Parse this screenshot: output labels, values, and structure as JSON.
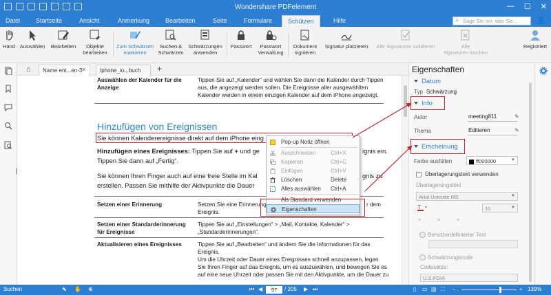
{
  "app_title": "Wondershare PDFelement",
  "menu": [
    "Datei",
    "Startseite",
    "Ansicht",
    "Anmerkung",
    "Bearbeiten",
    "Seite",
    "Formulare",
    "Schützen",
    "Hilfe"
  ],
  "search_placeholder": "Sage Sie mir, was Sie...",
  "ribbon": {
    "hand": "Hand",
    "select": "Auswählen",
    "edit": "Bearbeiten",
    "edit_objects": [
      "Objekte",
      "bearbeiten"
    ],
    "mark_redact": [
      "Zum Schwärzen",
      "markieren"
    ],
    "search_redact": [
      "Suchen &",
      "Schwärzen"
    ],
    "apply_redact": [
      "Schwärzungen",
      "anwenden"
    ],
    "password": "Passwort",
    "password_mgmt": [
      "Passwort",
      "Verwaltung"
    ],
    "sign_doc": [
      "Dokument",
      "signieren"
    ],
    "place_sig": "Signatur platzieren",
    "validate_all": "Alle Signaturen validieren",
    "delete_all": [
      "Alle",
      "Signaturen löschen"
    ],
    "registered": "Registriert"
  },
  "tabs": [
    {
      "label": "Name ent...en-3",
      "active": true
    },
    {
      "label": "Iphone_io...buch",
      "active": false
    }
  ],
  "document": {
    "row1_label": [
      "Auswählen der Kalender für die",
      "Anzeige"
    ],
    "row1_text": [
      "Tippen Sie auf „Kalender“ und wählen Sie dann die Kalender durch Tippen",
      "aus, die angezeigt werden sollen. Die Ereignisse aller ausgewählten",
      "Kalender werden in einem einzigen Kalender auf dem iPhone angezeigt."
    ],
    "heading": "Hinzufügen von Ereignissen",
    "para1": "Sie können Kalenderereignisse direkt auf dem iPhone eing",
    "para2_bold": "Hinzufügen eines Ereignisses:",
    "para2_a": " Tippen Sie auf ",
    "para2_plus": "+",
    "para2_b": " und ge",
    "para2_tail": "ignis ein.",
    "para2_line2": "Tippen Sie dann auf „Fertig“.",
    "para3_line1": "Sie können Ihren Finger auch auf eine freie Stelle im Kal",
    "para3_line1_tail": "gnis zu",
    "para3_line2": "erstellen. Passen Sie mithilfe der Aktivpunkte die Dauer",
    "row2_label": "Setzen einer Erinnerung",
    "row2_text": [
      "Setzen Sie eine Erinnerung",
      "r dem",
      "Ereignis."
    ],
    "row3_label": [
      "Setzen einer Standarderinnerung",
      "für Ereignisse"
    ],
    "row3_text": [
      "Tippen Sie auf „Einstellungen“ > „Mail, Kontakte, Kalender“ >",
      "„Standarderinnerungen“."
    ],
    "row4_label": "Aktualisieren eines Ereignisses",
    "row4_text": [
      "Tippen Sie auf „Bearbeiten“ und ändern Sie die Informationen für das",
      "Ereignis.",
      "Um die Uhrzeit oder Dauer eines Ereignisses schnell anzupassen, legen",
      "Sie Ihren Finger auf das Ereignis, um es auszuwählen, und bewegen Sie es",
      "auf eine neue Uhrzeit oder passen Sie mit den Aktivpunkte, um die Dauer zu"
    ]
  },
  "context_menu": {
    "items": [
      {
        "label": "Pop-up Notiz öffnen",
        "shortcut": "",
        "disabled": false,
        "icon": "note-icon"
      },
      {
        "label": "Ausschneiden",
        "shortcut": "Ctrl+X",
        "disabled": true,
        "icon": "cut-icon"
      },
      {
        "label": "Kopieren",
        "shortcut": "Ctrl+C",
        "disabled": true,
        "icon": "copy-icon"
      },
      {
        "label": "Einfügen",
        "shortcut": "Ctrl+V",
        "disabled": true,
        "icon": "paste-icon"
      },
      {
        "label": "Löschen",
        "shortcut": "Delete",
        "disabled": false,
        "icon": "trash-icon"
      },
      {
        "label": "Alles auswählen",
        "shortcut": "Ctrl+A",
        "disabled": false,
        "icon": "select-all-icon"
      },
      {
        "label": "Als Standard verwenden",
        "shortcut": "",
        "disabled": false,
        "icon": ""
      },
      {
        "label": "Eigenschaften",
        "shortcut": "",
        "disabled": false,
        "icon": "gear-icon"
      }
    ]
  },
  "properties": {
    "title": "Eigenschaften",
    "datum": "Datum",
    "typ_label": "Typ",
    "typ_value": "Schwärzung",
    "info": "Info",
    "autor_label": "Autor",
    "autor_value": "meeting811",
    "thema_label": "Thema",
    "thema_value": "Editieren",
    "erscheinung": "Erscheinung",
    "fill_label": "Farbe ausfüllen",
    "fill_value": "ff000000",
    "overlay_check": "Überlagerungstext verwenden",
    "overlay_label": "Überlagerungstext",
    "font": "Arial Unicode MS",
    "font_size": "10",
    "custom_text": "Benutzerdefinierter Text",
    "redact_code": "Schwärzungscode",
    "codesets_label": "Codesätze:",
    "codeset_value": "U.S.FOIA"
  },
  "status": {
    "left": "Suchen",
    "page": "97",
    "total": "/ 205",
    "zoom": "139%"
  },
  "colors": {
    "brand": "#2e7fd1",
    "heading": "#2b8ac8",
    "annotation_red": "#c0272d"
  }
}
